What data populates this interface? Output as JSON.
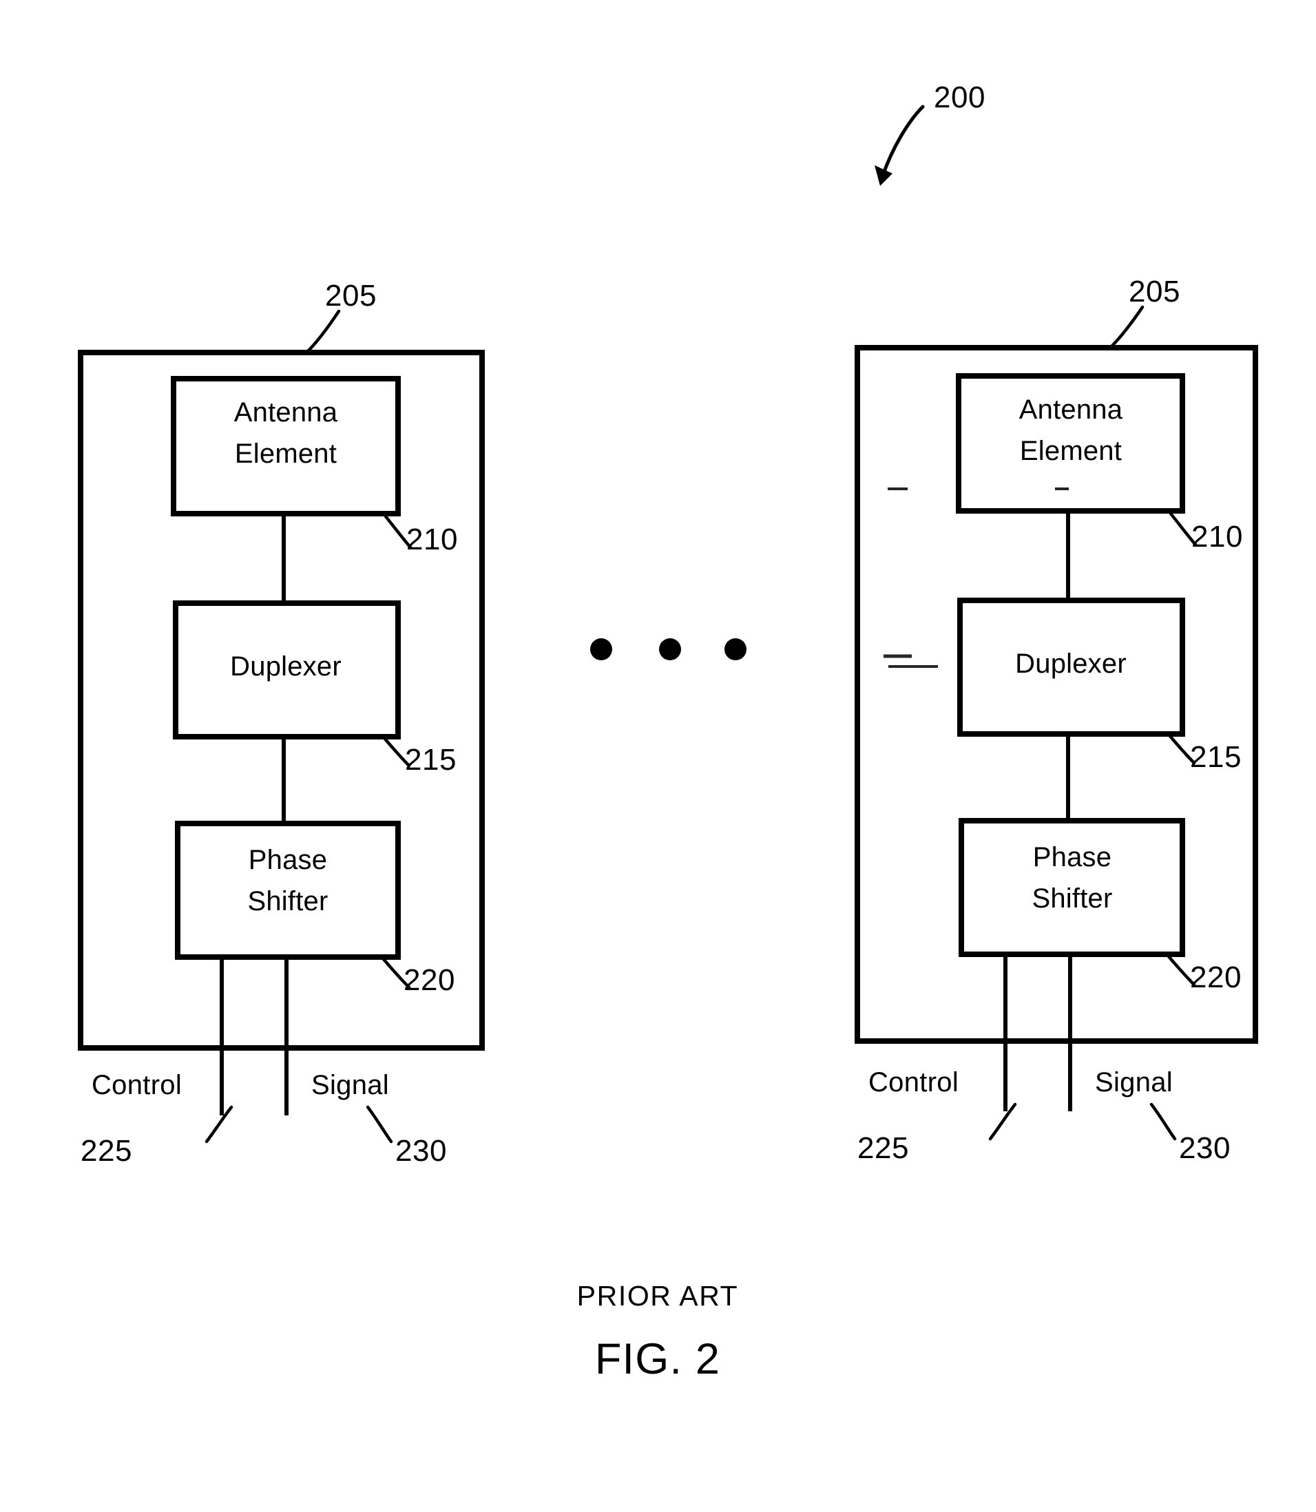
{
  "figure": {
    "system_ref": "200",
    "prior_art_text": "PRIOR ART",
    "caption": "FIG. 2"
  },
  "modules": [
    {
      "id": "module-left",
      "module_ref": "205",
      "blocks": [
        {
          "name": "antenna-element",
          "line1": "Antenna",
          "line2": "Element",
          "ref": "210"
        },
        {
          "name": "duplexer",
          "line1": "Duplexer",
          "line2": "",
          "ref": "215"
        },
        {
          "name": "phase-shifter",
          "line1": "Phase",
          "line2": "Shifter",
          "ref": "220"
        }
      ],
      "ports": [
        {
          "name": "control",
          "label": "Control",
          "ref": "225"
        },
        {
          "name": "signal",
          "label": "Signal",
          "ref": "230"
        }
      ]
    },
    {
      "id": "module-right",
      "module_ref": "205",
      "blocks": [
        {
          "name": "antenna-element",
          "line1": "Antenna",
          "line2": "Element",
          "ref": "210"
        },
        {
          "name": "duplexer",
          "line1": "Duplexer",
          "line2": "",
          "ref": "215"
        },
        {
          "name": "phase-shifter",
          "line1": "Phase",
          "line2": "Shifter",
          "ref": "220"
        }
      ],
      "ports": [
        {
          "name": "control",
          "label": "Control",
          "ref": "225"
        },
        {
          "name": "signal",
          "label": "Signal",
          "ref": "230"
        }
      ]
    }
  ],
  "ellipsis": {
    "name": "repetition-ellipsis",
    "dot_count": 3
  },
  "colors": {
    "ink": "#000000",
    "paper": "#ffffff"
  }
}
